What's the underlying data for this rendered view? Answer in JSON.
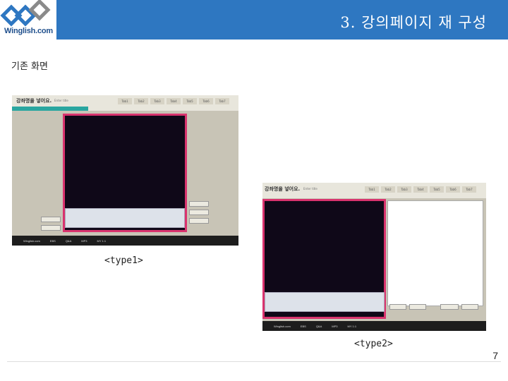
{
  "header": {
    "logo_text": "Winglish.com",
    "title": "3. 강의페이지 재 구성",
    "brand_color": "#2E77C1"
  },
  "subtitle": "기존 화면",
  "shots": [
    {
      "caption": "<type1>",
      "header_title": "강좌명을 넣어요. ",
      "header_sub": "Enter title",
      "tabs": [
        "Tab1",
        "Tab2",
        "Tab3",
        "Tab4",
        "Tab5",
        "Tab6",
        "Tab7"
      ],
      "footer_items": [
        "Winglish.com",
        "EBS",
        "Q&A",
        "MP3",
        "MY 1:1"
      ]
    },
    {
      "caption": "<type2>",
      "header_title": "강좌명을 넣어요. ",
      "header_sub": "Enter title",
      "tabs": [
        "Tab1",
        "Tab2",
        "Tab3",
        "Tab4",
        "Tab5",
        "Tab6",
        "Tab7"
      ],
      "footer_items": [
        "Winglish.com",
        "EBS",
        "Q&A",
        "MP3",
        "MY 1:1"
      ]
    }
  ],
  "page_number": "7"
}
